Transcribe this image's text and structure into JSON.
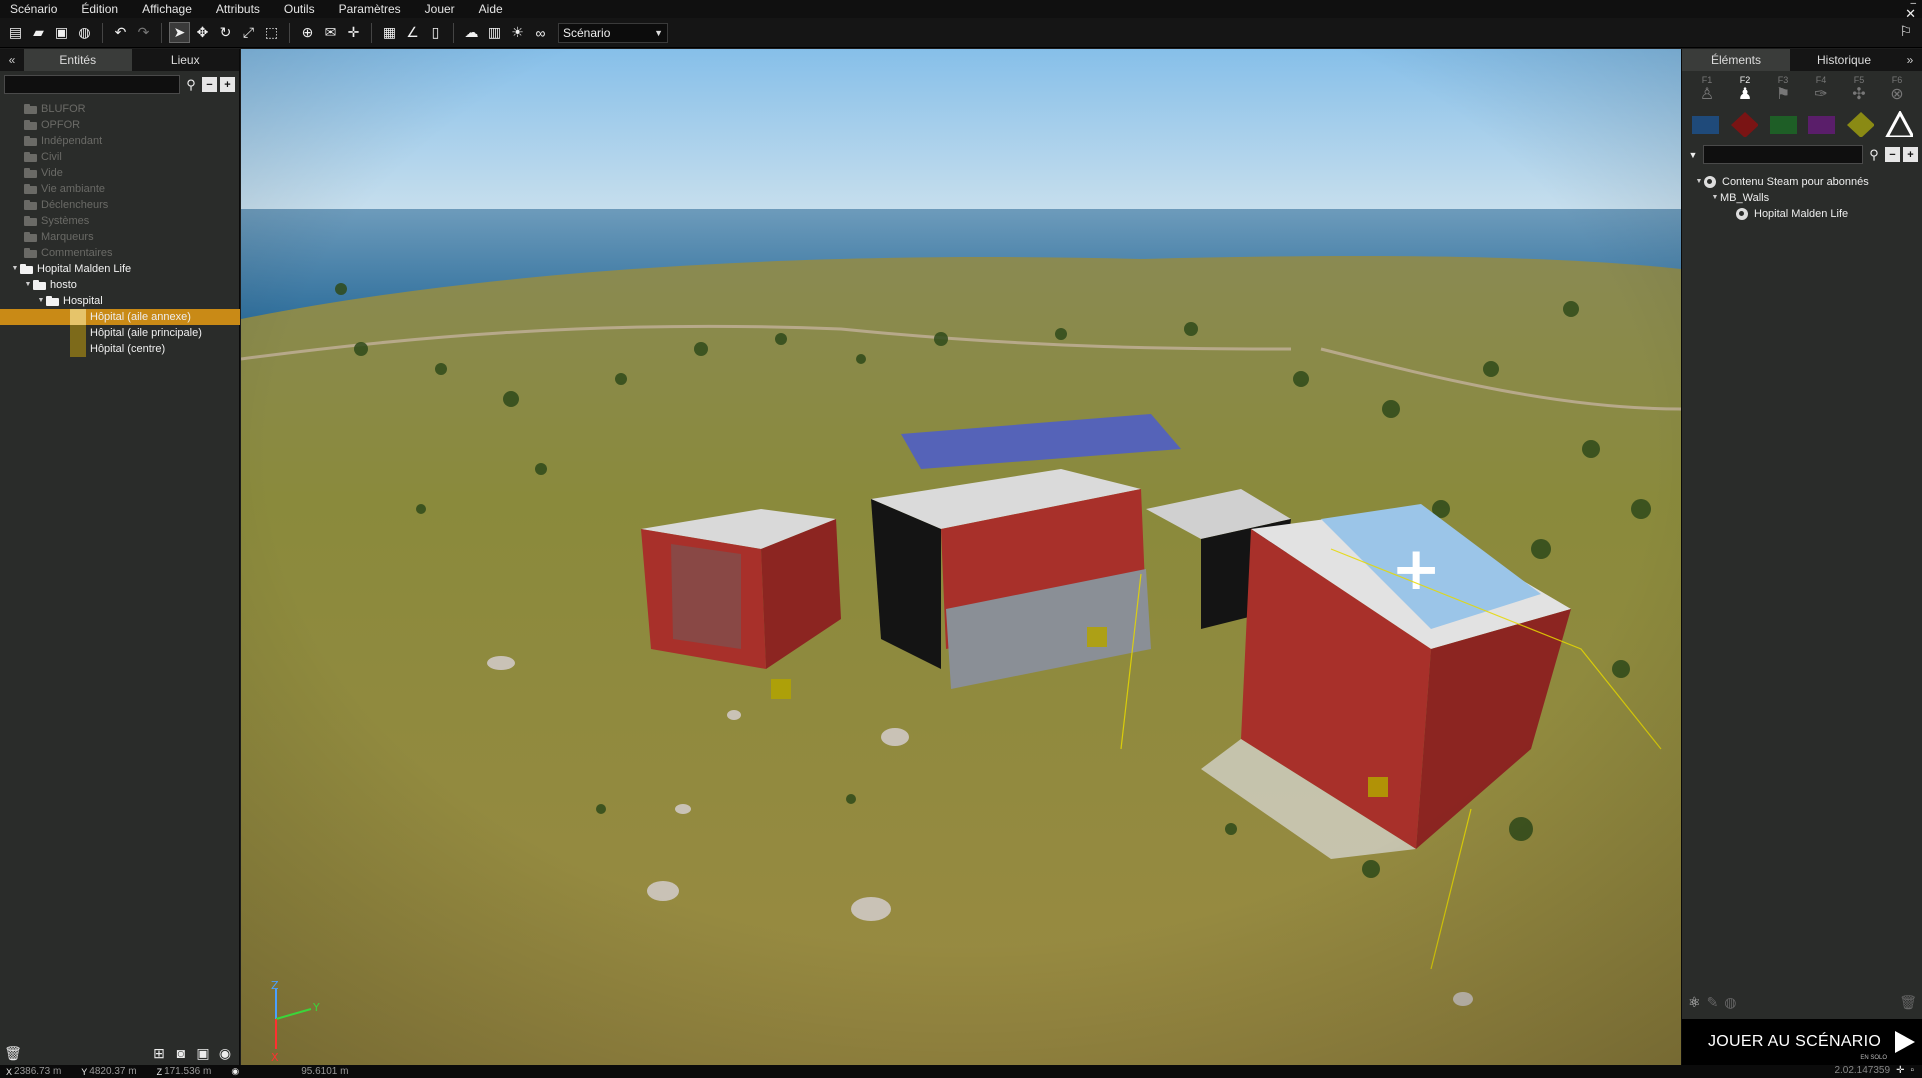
{
  "menu": [
    "Scénario",
    "Édition",
    "Affichage",
    "Attributs",
    "Outils",
    "Paramètres",
    "Jouer",
    "Aide"
  ],
  "toolbar": {
    "mode_value": "Scénario",
    "icons": [
      "new-file-icon",
      "open-folder-icon",
      "save-icon",
      "steam-publish-icon",
      "undo-icon",
      "redo-icon",
      "select-icon",
      "move-icon",
      "rotate-icon",
      "scale-icon",
      "area-select-icon",
      "globe-icon",
      "mail-icon",
      "vertical-snap-icon",
      "grid-icon",
      "angle-snap-icon",
      "vertical-ruler-icon",
      "weather-icon",
      "map-textures-icon",
      "lighting-icon",
      "vision-mode-icon"
    ]
  },
  "left_panel": {
    "tabs": [
      "Entités",
      "Lieux"
    ],
    "collapse_label": "«",
    "search_value": "",
    "tree": [
      {
        "label": "BLUFOR",
        "level": 0,
        "kind": "layer",
        "dim": true
      },
      {
        "label": "OPFOR",
        "level": 0,
        "kind": "layer",
        "dim": true
      },
      {
        "label": "Indépendant",
        "level": 0,
        "kind": "layer",
        "dim": true
      },
      {
        "label": "Civil",
        "level": 0,
        "kind": "layer",
        "dim": true
      },
      {
        "label": "Vide",
        "level": 0,
        "kind": "layer",
        "dim": true
      },
      {
        "label": "Vie ambiante",
        "level": 0,
        "kind": "layer",
        "dim": true
      },
      {
        "label": "Déclencheurs",
        "level": 0,
        "kind": "layer",
        "dim": true
      },
      {
        "label": "Systèmes",
        "level": 0,
        "kind": "layer",
        "dim": true
      },
      {
        "label": "Marqueurs",
        "level": 0,
        "kind": "layer",
        "dim": true
      },
      {
        "label": "Commentaires",
        "level": 0,
        "kind": "layer",
        "dim": true
      },
      {
        "label": "Hopital Malden Life",
        "level": 0,
        "kind": "folder",
        "expanded": true
      },
      {
        "label": "hosto",
        "level": 1,
        "kind": "folder",
        "expanded": true
      },
      {
        "label": "Hospital",
        "level": 2,
        "kind": "folder",
        "expanded": true
      },
      {
        "label": "Hôpital (aile annexe)",
        "level": 3,
        "kind": "item",
        "selected": true
      },
      {
        "label": "Hôpital (aile principale)",
        "level": 3,
        "kind": "item"
      },
      {
        "label": "Hôpital (centre)",
        "level": 3,
        "kind": "item"
      }
    ]
  },
  "right_panel": {
    "tabs": [
      "Éléments",
      "Historique"
    ],
    "expand_label": "»",
    "fkeys": [
      {
        "key": "F1",
        "icon": "unit-icon",
        "glyph": "♙"
      },
      {
        "key": "F2",
        "icon": "groups-icon",
        "glyph": "♟",
        "active": true
      },
      {
        "key": "F3",
        "icon": "modules-icon",
        "glyph": "⚑"
      },
      {
        "key": "F4",
        "icon": "waypoints-icon",
        "glyph": "✑"
      },
      {
        "key": "F5",
        "icon": "systems-icon",
        "glyph": "✣"
      },
      {
        "key": "F6",
        "icon": "markers-icon",
        "glyph": "⊗"
      }
    ],
    "factions": [
      {
        "name": "blufor",
        "color": "#1f4a7a",
        "shape": "rect"
      },
      {
        "name": "opfor",
        "color": "#7a1414",
        "shape": "diamond"
      },
      {
        "name": "independent",
        "color": "#1e5e26",
        "shape": "rect"
      },
      {
        "name": "civilian",
        "color": "#5a1e6a",
        "shape": "rect"
      },
      {
        "name": "empty",
        "color": "#8a8a14",
        "shape": "diamond"
      },
      {
        "name": "custom",
        "color": "#ffffff",
        "shape": "triangle"
      }
    ],
    "search_value": "",
    "tree": [
      {
        "label": "Contenu Steam pour abonnés",
        "level": 0,
        "steam": true,
        "expanded": true
      },
      {
        "label": "MB_Walls",
        "level": 1,
        "expanded": true
      },
      {
        "label": "Hopital Malden Life",
        "level": 2,
        "steam": true
      }
    ],
    "play": {
      "label": "JOUER AU SCÉNARIO",
      "sub": "EN SOLO"
    }
  },
  "statusbar": {
    "coords": [
      {
        "axis": "X",
        "value": "2386.73 m"
      },
      {
        "axis": "Y",
        "value": "4820.37 m"
      },
      {
        "axis": "Z",
        "value": "171.536 m"
      }
    ],
    "view_distance": "95.6101 m",
    "scale": "2.02.147359"
  },
  "colors": {
    "accent_selected": "#c98a16",
    "panel_bg": "#2a2c2a"
  }
}
